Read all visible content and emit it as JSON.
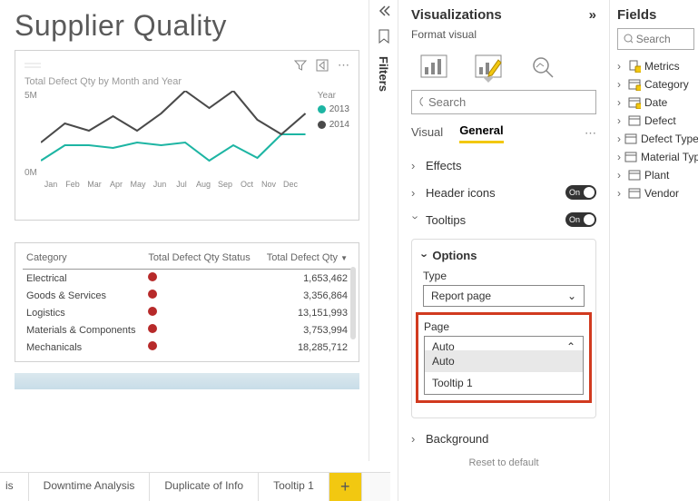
{
  "report": {
    "title": "Supplier Quality"
  },
  "chart": {
    "subtitle": "Total Defect Qty by Month and Year",
    "legend_title": "Year",
    "series": [
      "2013",
      "2014"
    ],
    "colors": {
      "2013": "#1db5a3",
      "2014": "#4a4a4a"
    },
    "y_ticks": [
      "5M",
      "0M"
    ]
  },
  "chart_data": {
    "type": "line",
    "categories": [
      "Jan",
      "Feb",
      "Mar",
      "Apr",
      "May",
      "Jun",
      "Jul",
      "Aug",
      "Sep",
      "Oct",
      "Nov",
      "Dec"
    ],
    "series": [
      {
        "name": "2013",
        "values": [
          1.0,
          2.0,
          2.0,
          1.8,
          2.2,
          2.0,
          2.2,
          1.0,
          2.0,
          1.2,
          2.8,
          2.8
        ]
      },
      {
        "name": "2014",
        "values": [
          2.2,
          3.5,
          3.0,
          4.0,
          3.0,
          4.2,
          5.8,
          4.6,
          6.0,
          3.8,
          2.8,
          4.2
        ]
      }
    ],
    "ylabel": "",
    "xlabel": "",
    "ylim": [
      0,
      6
    ]
  },
  "table": {
    "headers": {
      "category": "Category",
      "status": "Total Defect Qty Status",
      "qty": "Total Defect Qty"
    },
    "rows": [
      {
        "category": "Electrical",
        "qty": "1,653,462"
      },
      {
        "category": "Goods & Services",
        "qty": "3,356,864"
      },
      {
        "category": "Logistics",
        "qty": "13,151,993"
      },
      {
        "category": "Materials & Components",
        "qty": "3,753,994"
      },
      {
        "category": "Mechanicals",
        "qty": "18,285,712"
      }
    ]
  },
  "tabs": {
    "t0": "is",
    "t1": "Downtime Analysis",
    "t2": "Duplicate of Info",
    "t3": "Tooltip 1"
  },
  "filters": {
    "label": "Filters"
  },
  "viz_pane": {
    "title": "Visualizations",
    "subtitle": "Format visual",
    "search_ph": "Search",
    "tab_visual": "Visual",
    "tab_general": "General",
    "effects": "Effects",
    "header_icons": "Header icons",
    "tooltips": "Tooltips",
    "options": "Options",
    "type_label": "Type",
    "type_value": "Report page",
    "page_label": "Page",
    "page_value": "Auto",
    "page_opts": {
      "o0": "Auto",
      "o1": "Tooltip 1"
    },
    "toggle_on": "On",
    "background": "Background",
    "reset": "Reset to default"
  },
  "fields": {
    "title": "Fields",
    "search_ph": "Search",
    "items": {
      "i0": "Metrics",
      "i1": "Category",
      "i2": "Date",
      "i3": "Defect",
      "i4": "Defect Type",
      "i5": "Material Type",
      "i6": "Plant",
      "i7": "Vendor"
    }
  }
}
